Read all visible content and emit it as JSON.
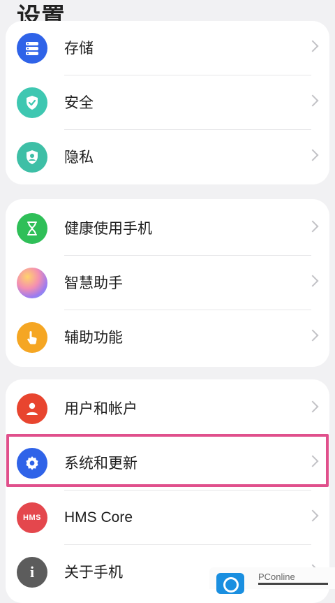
{
  "header": {
    "title": "设置"
  },
  "groups": [
    {
      "items": [
        {
          "label": "存储",
          "icon": "storage-icon",
          "color": "#2f63e8"
        },
        {
          "label": "安全",
          "icon": "security-shield-icon",
          "color": "#3ec7b1"
        },
        {
          "label": "隐私",
          "icon": "privacy-icon",
          "color": "#3ebfa6"
        }
      ]
    },
    {
      "items": [
        {
          "label": "健康使用手机",
          "icon": "hourglass-icon",
          "color": "#2fbf58"
        },
        {
          "label": "智慧助手",
          "icon": "assistant-orb-icon",
          "color": "#c98be9"
        },
        {
          "label": "辅助功能",
          "icon": "hand-pointer-icon",
          "color": "#f5a623"
        }
      ]
    },
    {
      "items": [
        {
          "label": "用户和帐户",
          "icon": "user-icon",
          "color": "#e8452f"
        },
        {
          "label": "系统和更新",
          "icon": "gear-icon",
          "color": "#2f63e8"
        },
        {
          "label": "HMS Core",
          "icon": "hms-icon",
          "icon_text": "HMS",
          "color": "#e4474d"
        },
        {
          "label": "关于手机",
          "icon": "info-icon",
          "icon_text": "i",
          "color": "#5c5c5c"
        }
      ]
    }
  ],
  "watermark": {
    "text": "PConline",
    "icon": "pconline-logo-icon",
    "color": "#1a8fe0"
  },
  "highlight_color": "#e0508c"
}
